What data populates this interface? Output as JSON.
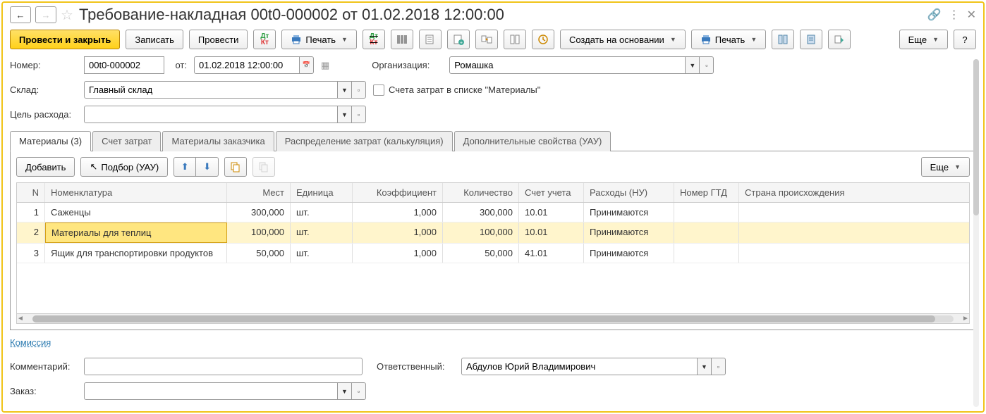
{
  "title": "Требование-накладная 00t0-000002 от 01.02.2018 12:00:00",
  "toolbar": {
    "post_close": "Провести и закрыть",
    "save": "Записать",
    "post": "Провести",
    "print1": "Печать",
    "create_based": "Создать на основании",
    "print2": "Печать",
    "more": "Еще",
    "help": "?"
  },
  "form": {
    "number_label": "Номер:",
    "number": "00t0-000002",
    "from_label": "от:",
    "date": "01.02.2018 12:00:00",
    "org_label": "Организация:",
    "org": "Ромашка",
    "wh_label": "Склад:",
    "wh": "Главный склад",
    "cb_label": "Счета затрат в списке \"Материалы\"",
    "purpose_label": "Цель расхода:",
    "purpose": ""
  },
  "tabs": [
    "Материалы (3)",
    "Счет затрат",
    "Материалы заказчика",
    "Распределение затрат (калькуляция)",
    "Дополнительные свойства (УАУ)"
  ],
  "tab_tb": {
    "add": "Добавить",
    "pick": "Подбор (УАУ)",
    "more": "Еще"
  },
  "cols": {
    "n": "N",
    "nom": "Номенклатура",
    "mest": "Мест",
    "ed": "Единица",
    "koef": "Коэффициент",
    "qty": "Количество",
    "acct": "Счет учета",
    "rash": "Расходы (НУ)",
    "gtd": "Номер ГТД",
    "orig": "Страна происхождения"
  },
  "rows": [
    {
      "n": "1",
      "nom": "Саженцы",
      "mest": "300,000",
      "ed": "шт.",
      "koef": "1,000",
      "qty": "300,000",
      "acct": "10.01",
      "rash": "Принимаются",
      "gtd": "",
      "orig": ""
    },
    {
      "n": "2",
      "nom": "Материалы для теплиц",
      "mest": "100,000",
      "ed": "шт.",
      "koef": "1,000",
      "qty": "100,000",
      "acct": "10.01",
      "rash": "Принимаются",
      "gtd": "",
      "orig": ""
    },
    {
      "n": "3",
      "nom": "Ящик для транспортировки продуктов",
      "mest": "50,000",
      "ed": "шт.",
      "koef": "1,000",
      "qty": "50,000",
      "acct": "41.01",
      "rash": "Принимаются",
      "gtd": "",
      "orig": ""
    }
  ],
  "footer": {
    "commission": "Комиссия",
    "comment_label": "Комментарий:",
    "comment": "",
    "resp_label": "Ответственный:",
    "resp": "Абдулов Юрий Владимирович",
    "order_label": "Заказ:",
    "order": ""
  }
}
